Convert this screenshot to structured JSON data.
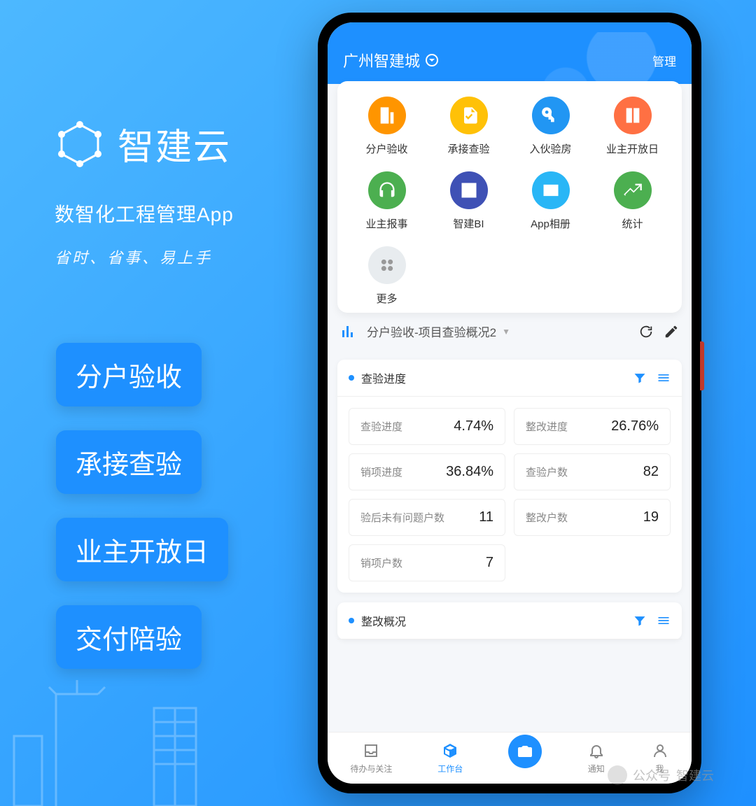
{
  "promo": {
    "product_name": "智建云",
    "subtitle": "数智化工程管理App",
    "slogan": "省时、省事、易上手"
  },
  "tags": [
    "分户验收",
    "承接查验",
    "业主开放日",
    "交付陪验"
  ],
  "phone": {
    "header": {
      "title": "广州智建城",
      "manage": "管理"
    },
    "apps": [
      {
        "label": "分户验收",
        "color": "#ff9500",
        "icon": "building"
      },
      {
        "label": "承接查验",
        "color": "#ffc107",
        "icon": "clipboard"
      },
      {
        "label": "入伙验房",
        "color": "#2196f3",
        "icon": "key"
      },
      {
        "label": "业主开放日",
        "color": "#ff7043",
        "icon": "door"
      },
      {
        "label": "业主报事",
        "color": "#4caf50",
        "icon": "headset"
      },
      {
        "label": "智建BI",
        "color": "#3f51b5",
        "icon": "chart"
      },
      {
        "label": "App相册",
        "color": "#29b6f6",
        "icon": "image"
      },
      {
        "label": "统计",
        "color": "#4caf50",
        "icon": "trend"
      },
      {
        "label": "更多",
        "color": "#e8ecef",
        "icon": "more"
      }
    ],
    "chart_dropdown": "分户验收-项目查验概况2",
    "panel1": {
      "title": "查验进度",
      "stats": [
        {
          "label": "查验进度",
          "value": "4.74%"
        },
        {
          "label": "整改进度",
          "value": "26.76%"
        },
        {
          "label": "销项进度",
          "value": "36.84%"
        },
        {
          "label": "查验户数",
          "value": "82"
        },
        {
          "label": "验后未有问题户数",
          "value": "11"
        },
        {
          "label": "整改户数",
          "value": "19"
        },
        {
          "label": "销项户数",
          "value": "7"
        }
      ]
    },
    "panel2": {
      "title": "整改概况"
    },
    "nav": [
      {
        "label": "待办与关注",
        "icon": "inbox"
      },
      {
        "label": "工作台",
        "icon": "workbench",
        "active": true
      },
      {
        "label": "",
        "icon": "camera"
      },
      {
        "label": "通知",
        "icon": "bell"
      },
      {
        "label": "我",
        "icon": "user"
      }
    ]
  },
  "watermark": {
    "prefix": "公众号",
    "name": "智建云"
  }
}
